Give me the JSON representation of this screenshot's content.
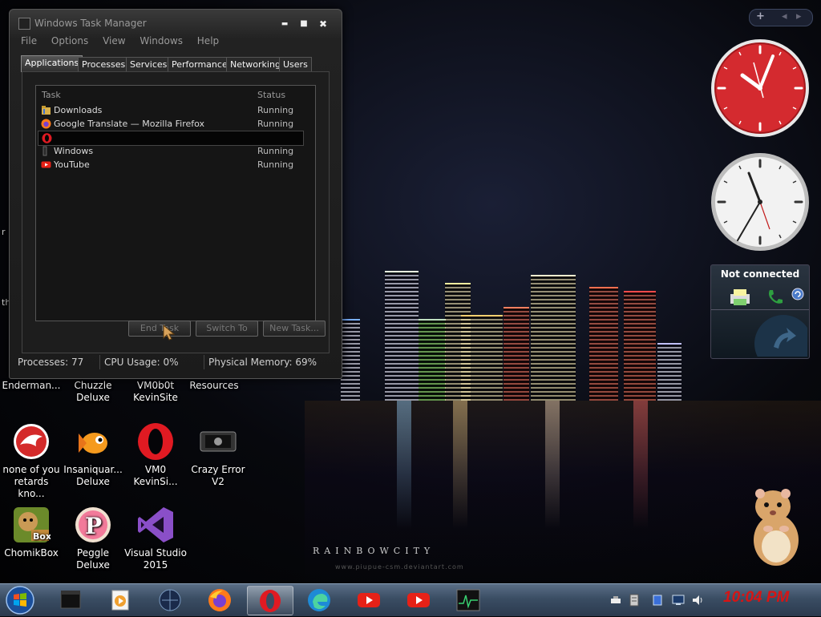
{
  "task_manager": {
    "title": "Windows Task Manager",
    "window_buttons": {
      "minimize": "▬",
      "maximize": "■",
      "close": "✖"
    },
    "menu": [
      "File",
      "Options",
      "View",
      "Windows",
      "Help"
    ],
    "tabs": [
      "Applications",
      "Processes",
      "Services",
      "Performance",
      "Networking",
      "Users"
    ],
    "active_tab": "Applications",
    "columns": {
      "task": "Task",
      "status": "Status"
    },
    "tasks": [
      {
        "name": "Downloads",
        "status": "Running",
        "icon": "folder-icon"
      },
      {
        "name": "Google Translate — Mozilla Firefox",
        "status": "Running",
        "icon": "firefox-icon"
      },
      {
        "name": "",
        "status": "",
        "icon": "opera-icon",
        "selected": true
      },
      {
        "name": "Windows",
        "status": "Running",
        "icon": "window-icon"
      },
      {
        "name": "YouTube",
        "status": "Running",
        "icon": "youtube-icon"
      }
    ],
    "buttons": {
      "end_task": "End Task",
      "switch_to": "Switch To",
      "new_task": "New Task..."
    },
    "status": {
      "processes": "Processes: 77",
      "cpu": "CPU Usage: 0%",
      "memory": "Physical Memory: 69%"
    }
  },
  "desktop_icons": [
    {
      "label": "Enderman...",
      "icon": "blank-icon"
    },
    {
      "label": "Chuzzle Deluxe",
      "icon": "blank-icon"
    },
    {
      "label": "VM0b0t KevinSite",
      "icon": "blank-icon"
    },
    {
      "label": "Resources",
      "icon": "blank-icon"
    },
    {
      "label": "none of you retards kno...",
      "icon": "red-bird-icon"
    },
    {
      "label": "Insaniquar... Deluxe",
      "icon": "goldfish-icon"
    },
    {
      "label": "VM0 KevinSi...",
      "icon": "opera-icon"
    },
    {
      "label": "Crazy Error V2",
      "icon": "crazy-error-icon"
    },
    {
      "label": "ChomikBox",
      "icon": "chomikbox-icon"
    },
    {
      "label": "Peggle Deluxe",
      "icon": "peggle-icon"
    },
    {
      "label": "Visual Studio 2015",
      "icon": "visual-studio-icon"
    }
  ],
  "edge_letters": [
    "r",
    "r",
    "th"
  ],
  "gadgets": {
    "controls": {
      "add": "+",
      "prev": "◂",
      "next": "▸"
    },
    "network": {
      "title": "Not connected"
    }
  },
  "wallpaper": {
    "brand": "RAINBOWCITY",
    "sub": "www.piupue-csm.deviantart.com"
  },
  "taskbar": {
    "items": [
      "start-orb-icon",
      "black-box-icon",
      "media-player-icon",
      "network-globe-icon",
      "firefox-icon",
      "opera-icon",
      "edge-icon",
      "youtube-icon",
      "youtube-icon",
      "task-manager-icon"
    ],
    "active_index": 5,
    "clock": "10:04 PM"
  },
  "colors": {
    "clock_red": "#d81414",
    "taskbar": "#3a4d63",
    "analog_clock_red": "#d42a2f"
  }
}
